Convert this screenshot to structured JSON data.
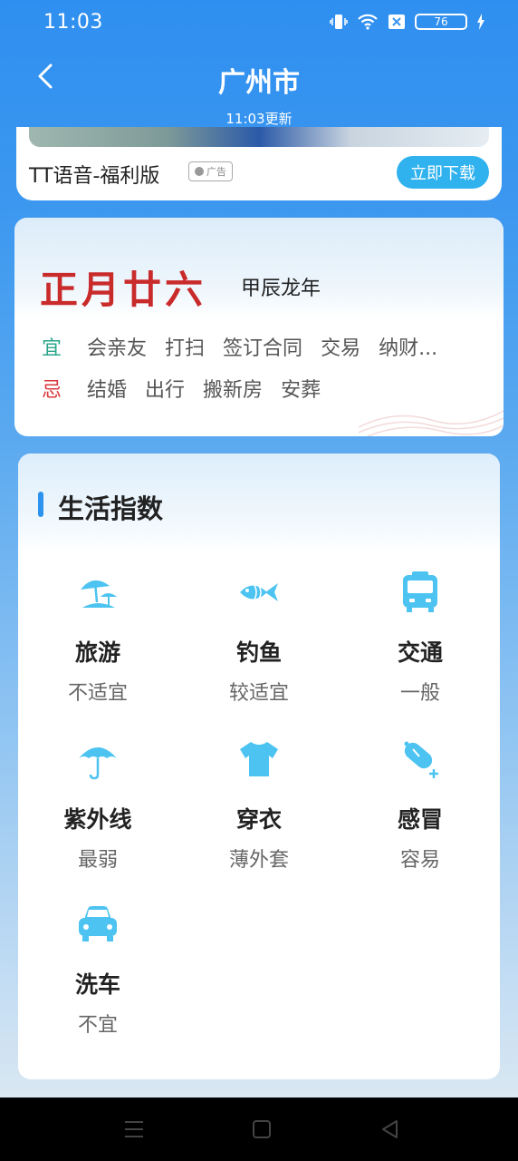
{
  "status_bar": {
    "time": "11:03",
    "battery": "76"
  },
  "header": {
    "title": "广州市",
    "update_time": "11:03更新"
  },
  "ad": {
    "title": "TT语音-福利版",
    "badge": "广告",
    "cta": "立即下载"
  },
  "almanac": {
    "lunar_date": "正月廿六",
    "year": "甲辰龙年",
    "good_label": "宜",
    "good_items": [
      "会亲友",
      "打扫",
      "签订合同",
      "交易",
      "纳财..."
    ],
    "bad_label": "忌",
    "bad_items": [
      "结婚",
      "出行",
      "搬新房",
      "安葬"
    ]
  },
  "life_index": {
    "title": "生活指数",
    "items": [
      {
        "name": "旅游",
        "value": "不适宜",
        "icon": "beach-umbrella-icon"
      },
      {
        "name": "钓鱼",
        "value": "较适宜",
        "icon": "fish-icon"
      },
      {
        "name": "交通",
        "value": "一般",
        "icon": "bus-icon"
      },
      {
        "name": "紫外线",
        "value": "最弱",
        "icon": "umbrella-icon"
      },
      {
        "name": "穿衣",
        "value": "薄外套",
        "icon": "tshirt-icon"
      },
      {
        "name": "感冒",
        "value": "容易",
        "icon": "pill-icon"
      },
      {
        "name": "洗车",
        "value": "不宜",
        "icon": "car-icon"
      }
    ]
  },
  "colors": {
    "accent": "#2d93ee",
    "icon": "#4cc3f0",
    "good": "#2aa58a",
    "bad": "#d9393c",
    "lunar": "#c92a2a"
  }
}
